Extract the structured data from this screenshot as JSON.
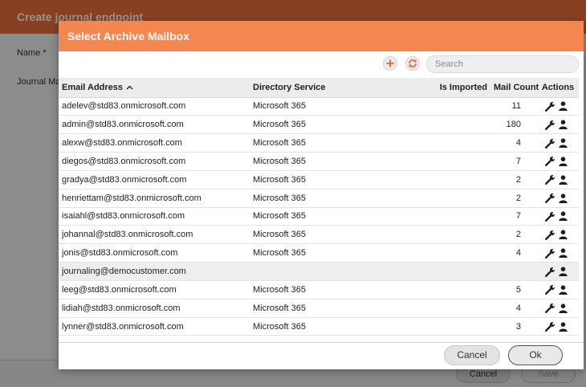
{
  "background": {
    "title": "Create journal endpoint",
    "name_label": "Name *",
    "journal_label": "Journal Mailbox",
    "cancel_label": "Cancel",
    "save_label": "Save"
  },
  "modal": {
    "title": "Select Archive Mailbox",
    "search_placeholder": "Search",
    "cancel_label": "Cancel",
    "ok_label": "Ok"
  },
  "table": {
    "headers": {
      "email": "Email Address",
      "service": "Directory Service",
      "imported": "Is Imported",
      "count": "Mail Count",
      "actions": "Actions"
    },
    "rows": [
      {
        "email": "adelev@std83.onmicrosoft.com",
        "service": "Microsoft 365",
        "imported": "",
        "count": "11"
      },
      {
        "email": "admin@std83.onmicrosoft.com",
        "service": "Microsoft 365",
        "imported": "",
        "count": "180"
      },
      {
        "email": "alexw@std83.onmicrosoft.com",
        "service": "Microsoft 365",
        "imported": "",
        "count": "4"
      },
      {
        "email": "diegos@std83.onmicrosoft.com",
        "service": "Microsoft 365",
        "imported": "",
        "count": "7"
      },
      {
        "email": "gradya@std83.onmicrosoft.com",
        "service": "Microsoft 365",
        "imported": "",
        "count": "2"
      },
      {
        "email": "henriettam@std83.onmicrosoft.com",
        "service": "Microsoft 365",
        "imported": "",
        "count": "2"
      },
      {
        "email": "isaiahl@std83.onmicrosoft.com",
        "service": "Microsoft 365",
        "imported": "",
        "count": "7"
      },
      {
        "email": "johannal@std83.onmicrosoft.com",
        "service": "Microsoft 365",
        "imported": "",
        "count": "2"
      },
      {
        "email": "jonis@std83.onmicrosoft.com",
        "service": "Microsoft 365",
        "imported": "",
        "count": "4"
      },
      {
        "email": "journaling@democustomer.com",
        "service": "",
        "imported": "",
        "count": "",
        "highlighted": true
      },
      {
        "email": "leeg@std83.onmicrosoft.com",
        "service": "Microsoft 365",
        "imported": "",
        "count": "5"
      },
      {
        "email": "lidiah@std83.onmicrosoft.com",
        "service": "Microsoft 365",
        "imported": "",
        "count": "4"
      },
      {
        "email": "lynner@std83.onmicrosoft.com",
        "service": "Microsoft 365",
        "imported": "",
        "count": "3"
      }
    ]
  },
  "icons": {
    "add": "plus-icon",
    "refresh": "refresh-icon",
    "wrench": "wrench-icon",
    "user": "user-icon",
    "sort": "sort-ascending-icon"
  },
  "colors": {
    "header_orange": "#e8703a",
    "modal_header_orange": "#f4874f",
    "accent": "#e8703a"
  }
}
